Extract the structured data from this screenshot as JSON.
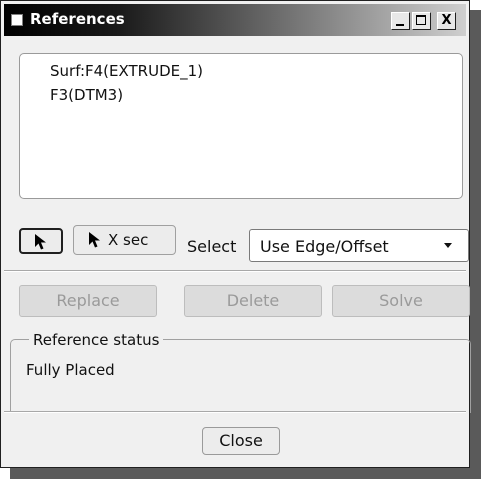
{
  "window": {
    "title": "References"
  },
  "title_buttons": {
    "minimize_icon": "minimize-icon",
    "maximize_icon": "maximize-icon",
    "close_icon": "close-icon",
    "close_glyph": "X"
  },
  "references": {
    "items": [
      "Surf:F4(EXTRUDE_1)",
      "F3(DTM3)"
    ]
  },
  "toolbar": {
    "select_icon": "arrow-pointer-icon",
    "xsec_label": "X sec",
    "select_label": "Select",
    "select_value": "Use Edge/Offset"
  },
  "actions": {
    "replace": "Replace",
    "delete": "Delete",
    "solve": "Solve"
  },
  "status_group": {
    "legend": "Reference status",
    "value": "Fully Placed"
  },
  "footer": {
    "close": "Close"
  },
  "colors": {
    "title_bar_start": "#000000",
    "title_bar_end": "#cfcfcf",
    "disabled_text": "#9a9a9a"
  }
}
